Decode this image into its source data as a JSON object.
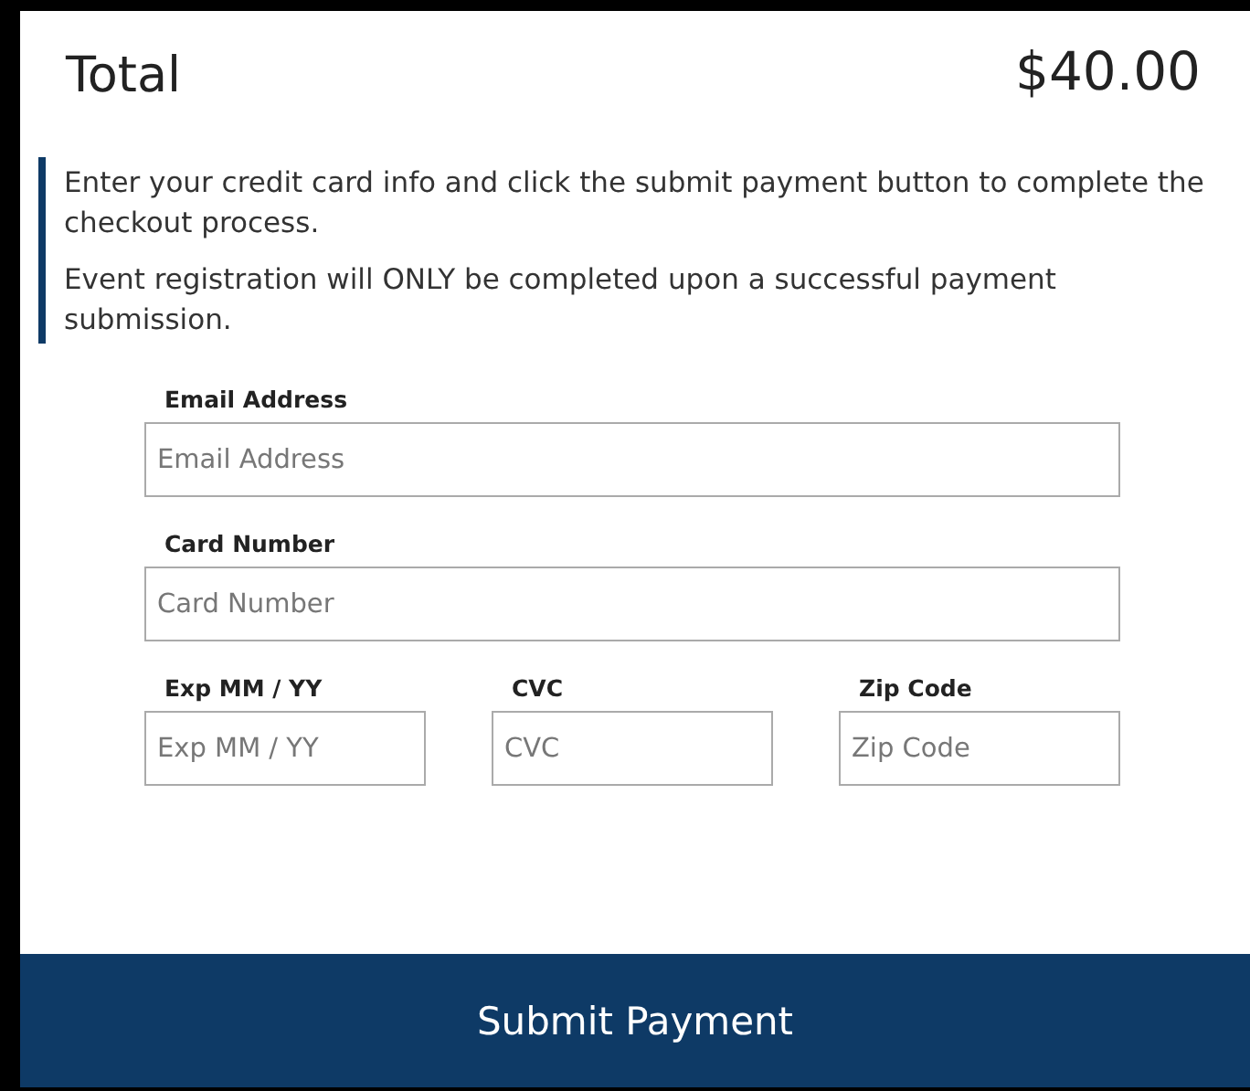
{
  "total": {
    "label": "Total",
    "amount": "$40.00"
  },
  "notice": [
    "Enter your credit card info and click the submit payment button to complete the checkout process.",
    "Event registration will ONLY be completed upon a successful payment submission."
  ],
  "fields": [
    {
      "label": "Email Address",
      "placeholder": "Email Address",
      "kind": "wide"
    },
    {
      "label": "Card Number",
      "placeholder": "Card Number",
      "kind": "wide"
    },
    {
      "label": "Exp MM / YY",
      "placeholder": "Exp MM / YY",
      "kind": "short"
    },
    {
      "label": "CVC",
      "placeholder": "CVC",
      "kind": "short"
    },
    {
      "label": "Zip Code",
      "placeholder": "Zip Code",
      "kind": "short"
    }
  ],
  "submit": "Submit Payment"
}
